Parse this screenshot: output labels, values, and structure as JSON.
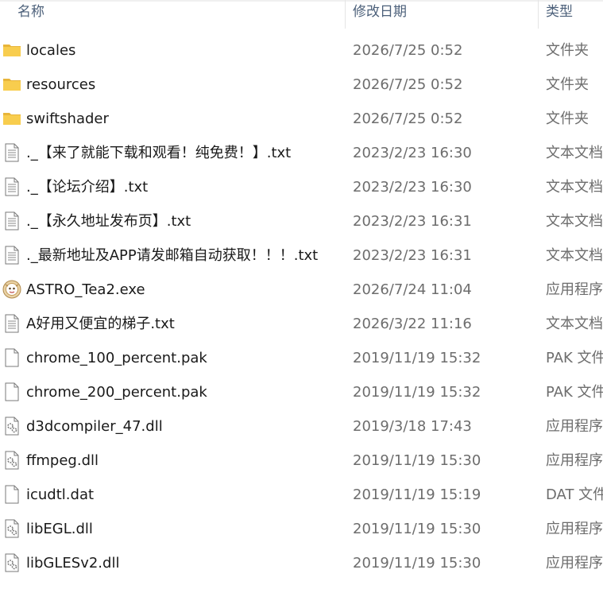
{
  "columns": {
    "name": "名称",
    "date": "修改日期",
    "type": "类型"
  },
  "files": [
    {
      "name": "locales",
      "date": "2026/7/25 0:52",
      "type": "文件夹",
      "icon": "folder-icon"
    },
    {
      "name": "resources",
      "date": "2026/7/25 0:52",
      "type": "文件夹",
      "icon": "folder-icon"
    },
    {
      "name": "swiftshader",
      "date": "2026/7/25 0:52",
      "type": "文件夹",
      "icon": "folder-icon"
    },
    {
      "name": "._【来了就能下载和观看！纯免费！】.txt",
      "date": "2023/2/23 16:30",
      "type": "文本文档",
      "icon": "text-file-icon"
    },
    {
      "name": "._【论坛介绍】.txt",
      "date": "2023/2/23 16:30",
      "type": "文本文档",
      "icon": "text-file-icon"
    },
    {
      "name": "._【永久地址发布页】.txt",
      "date": "2023/2/23 16:31",
      "type": "文本文档",
      "icon": "text-file-icon"
    },
    {
      "name": "._最新地址及APP请发邮箱自动获取！！！.txt",
      "date": "2023/2/23 16:31",
      "type": "文本文档",
      "icon": "text-file-icon"
    },
    {
      "name": "ASTRO_Tea2.exe",
      "date": "2026/7/24 11:04",
      "type": "应用程序",
      "icon": "app-exe-icon"
    },
    {
      "name": "A好用又便宜的梯子.txt",
      "date": "2026/3/22 11:16",
      "type": "文本文档",
      "icon": "text-file-icon"
    },
    {
      "name": "chrome_100_percent.pak",
      "date": "2019/11/19 15:32",
      "type": "PAK 文件",
      "icon": "blank-file-icon"
    },
    {
      "name": "chrome_200_percent.pak",
      "date": "2019/11/19 15:32",
      "type": "PAK 文件",
      "icon": "blank-file-icon"
    },
    {
      "name": "d3dcompiler_47.dll",
      "date": "2019/3/18 17:43",
      "type": "应用程序",
      "icon": "dll-file-icon"
    },
    {
      "name": "ffmpeg.dll",
      "date": "2019/11/19 15:30",
      "type": "应用程序",
      "icon": "dll-file-icon"
    },
    {
      "name": "icudtl.dat",
      "date": "2019/11/19 15:19",
      "type": "DAT 文件",
      "icon": "blank-file-icon"
    },
    {
      "name": "libEGL.dll",
      "date": "2019/11/19 15:30",
      "type": "应用程序",
      "icon": "dll-file-icon"
    },
    {
      "name": "libGLESv2.dll",
      "date": "2019/11/19 15:30",
      "type": "应用程序",
      "icon": "dll-file-icon"
    }
  ],
  "colors": {
    "folder": "#f5c542",
    "header_text": "#4c607a",
    "date_text": "#6d6d6d"
  }
}
